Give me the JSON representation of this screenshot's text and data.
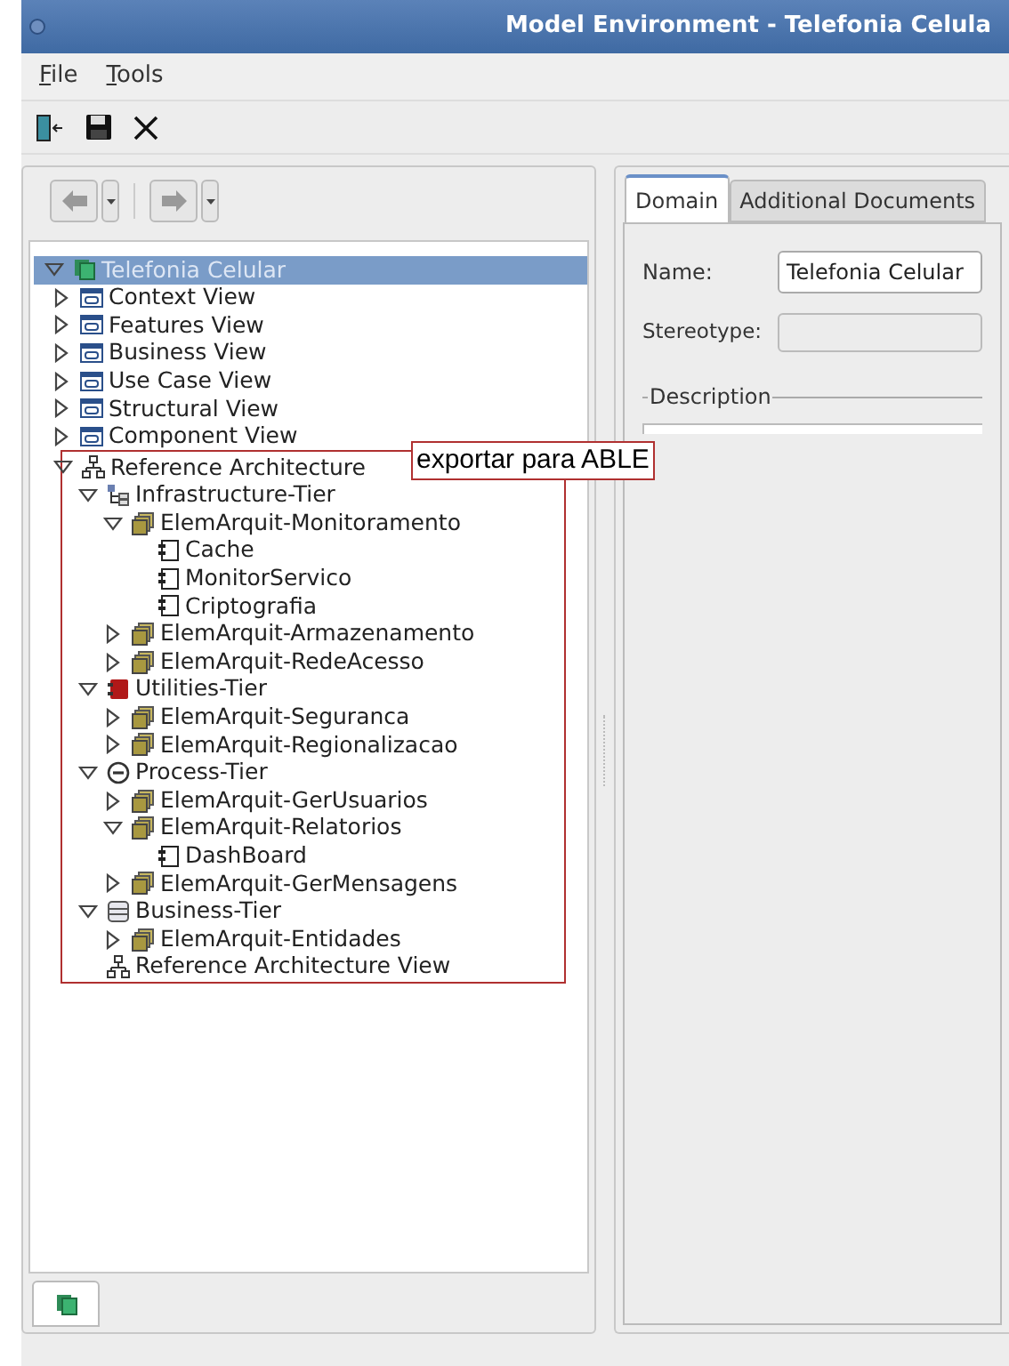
{
  "window": {
    "title": "Model Environment - Telefonia Celula"
  },
  "menu": [
    {
      "label": "File"
    },
    {
      "label": "Tools"
    }
  ],
  "tree": [
    {
      "label": "Telefonia Celular",
      "kind": "domain",
      "expanded": true,
      "selected": true,
      "children": [
        {
          "label": "Context View",
          "kind": "view",
          "expanded": false,
          "selected": false
        },
        {
          "label": "Features View",
          "kind": "view",
          "expanded": false,
          "selected": false
        },
        {
          "label": "Business View",
          "kind": "view",
          "expanded": false,
          "selected": false
        },
        {
          "label": "Use Case View",
          "kind": "view",
          "expanded": false,
          "selected": false
        },
        {
          "label": "Structural View",
          "kind": "view",
          "expanded": false,
          "selected": false
        },
        {
          "label": "Component View",
          "kind": "view",
          "expanded": false,
          "selected": false
        },
        {
          "label": "Reference Architecture",
          "kind": "architecture",
          "expanded": true,
          "selected": false,
          "annotation": "exportar para ABLE",
          "children": [
            {
              "label": "Infrastructure-Tier",
              "kind": "infra-tier",
              "expanded": true,
              "selected": false,
              "children": [
                {
                  "label": "ElemArquit-Monitoramento",
                  "kind": "element",
                  "expanded": true,
                  "selected": false,
                  "children": [
                    {
                      "label": "Cache",
                      "kind": "component",
                      "selected": false
                    },
                    {
                      "label": "MonitorServico",
                      "kind": "component",
                      "selected": false
                    },
                    {
                      "label": "Criptografia",
                      "kind": "component",
                      "selected": false
                    }
                  ]
                },
                {
                  "label": "ElemArquit-Armazenamento",
                  "kind": "element",
                  "expanded": false,
                  "selected": false
                },
                {
                  "label": "ElemArquit-RedeAcesso",
                  "kind": "element",
                  "expanded": false,
                  "selected": false
                }
              ]
            },
            {
              "label": "Utilities-Tier",
              "kind": "utilities-tier",
              "expanded": true,
              "selected": false,
              "children": [
                {
                  "label": "ElemArquit-Seguranca",
                  "kind": "element",
                  "expanded": false,
                  "selected": false
                },
                {
                  "label": "ElemArquit-Regionalizacao",
                  "kind": "element",
                  "expanded": false,
                  "selected": false
                }
              ]
            },
            {
              "label": "Process-Tier",
              "kind": "process-tier",
              "expanded": true,
              "selected": false,
              "children": [
                {
                  "label": "ElemArquit-GerUsuarios",
                  "kind": "element",
                  "expanded": false,
                  "selected": false
                },
                {
                  "label": "ElemArquit-Relatorios",
                  "kind": "element",
                  "expanded": true,
                  "selected": false,
                  "children": [
                    {
                      "label": "DashBoard",
                      "kind": "component",
                      "selected": false
                    }
                  ]
                },
                {
                  "label": "ElemArquit-GerMensagens",
                  "kind": "element",
                  "expanded": false,
                  "selected": false
                }
              ]
            },
            {
              "label": "Business-Tier",
              "kind": "business-tier",
              "expanded": true,
              "selected": false,
              "children": [
                {
                  "label": "ElemArquit-Entidades",
                  "kind": "element",
                  "expanded": false,
                  "selected": false
                }
              ]
            },
            {
              "label": "Reference Architecture View",
              "kind": "architecture",
              "selected": false
            }
          ]
        }
      ]
    }
  ],
  "tabs": [
    {
      "label": "Domain",
      "selected": true
    },
    {
      "label": "Additional Documents",
      "selected": false
    }
  ],
  "form": {
    "name_label": "Name:",
    "name_value": "Telefonia Celular",
    "stereotype_label": "Stereotype:",
    "description_label": "Description"
  }
}
